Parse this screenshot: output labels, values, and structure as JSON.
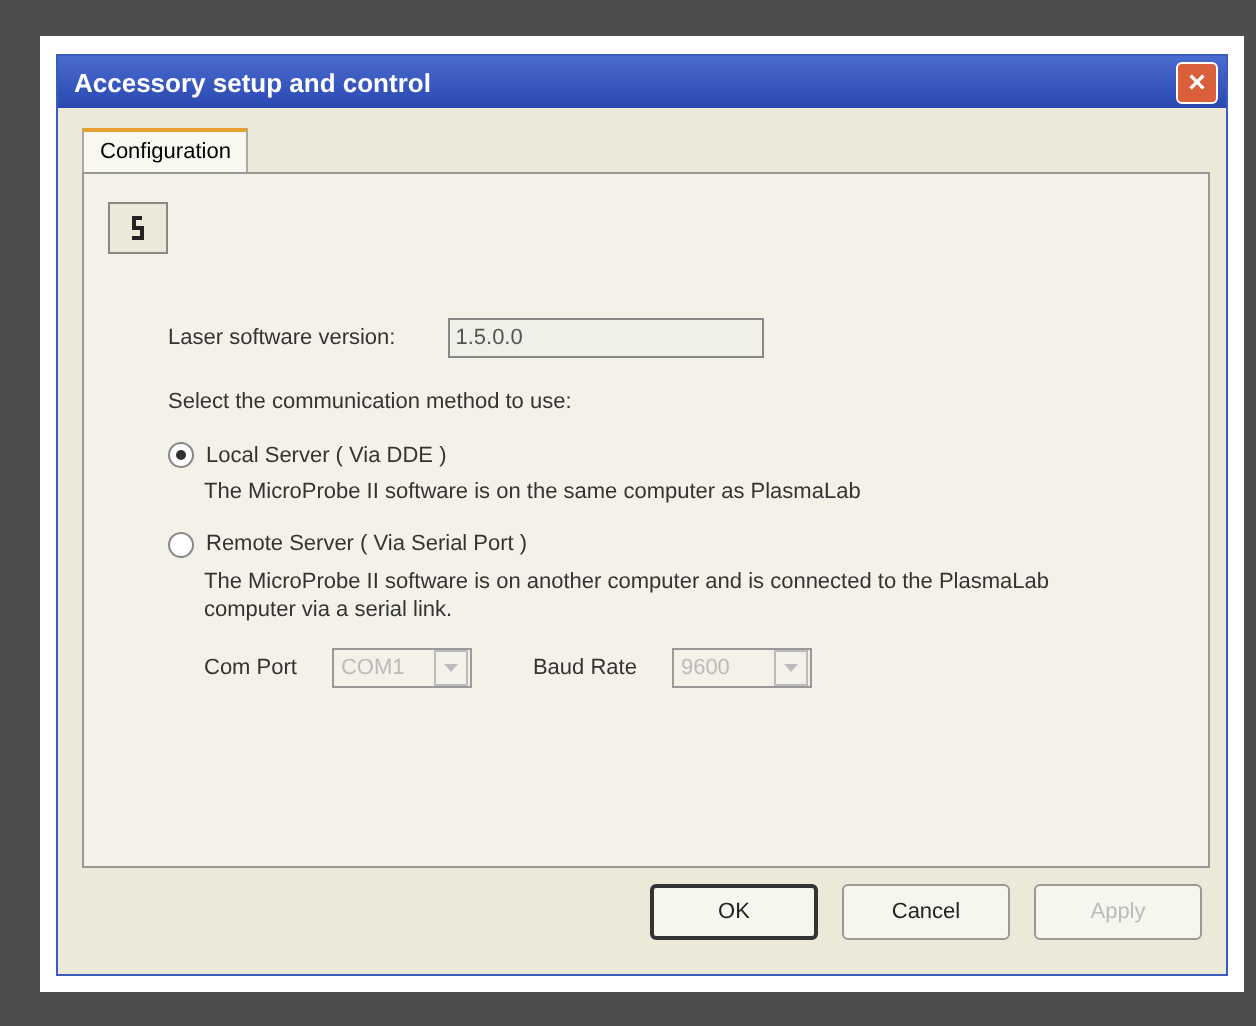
{
  "window": {
    "title": "Accessory setup and control",
    "close": "×"
  },
  "tabs": [
    {
      "label": "Configuration",
      "selected": true
    }
  ],
  "version": {
    "label": "Laser software version:",
    "value": "1.5.0.0"
  },
  "prompt": "Select the communication method to use:",
  "methods": [
    {
      "label": "Local Server ( Via DDE )",
      "selected": true,
      "description": "The MicroProbe II software is on the same computer as PlasmaLab"
    },
    {
      "label": "Remote Server ( Via Serial Port )",
      "selected": false,
      "description": "The MicroProbe II software is on another computer and is connected to the PlasmaLab computer via a serial link."
    }
  ],
  "serial": [
    {
      "label": "Com Port",
      "value": "COM1",
      "disabled": true
    },
    {
      "label": "Baud Rate",
      "value": "9600",
      "disabled": true
    }
  ],
  "buttons": [
    {
      "label": "OK",
      "default": true,
      "disabled": false
    },
    {
      "label": "Cancel",
      "default": false,
      "disabled": false
    },
    {
      "label": "Apply",
      "default": false,
      "disabled": true
    }
  ]
}
